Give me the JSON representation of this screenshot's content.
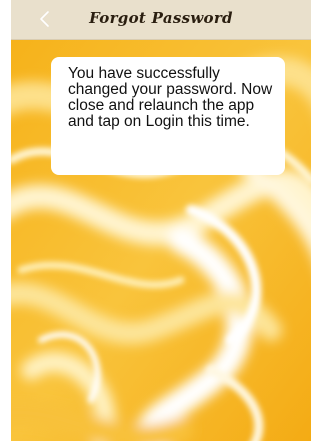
{
  "header": {
    "title": "Forgot Password",
    "back_icon": "chevron-left-icon",
    "background_color": "#e9e0cc"
  },
  "message": {
    "text": "You have successfully changed your password. Now close and relaunch the app and tap on Login this time."
  },
  "background": {
    "pattern": "swirled-marble",
    "colors": [
      "#f7b820",
      "#fbd35a",
      "#fff2c4",
      "#ffffff"
    ]
  }
}
